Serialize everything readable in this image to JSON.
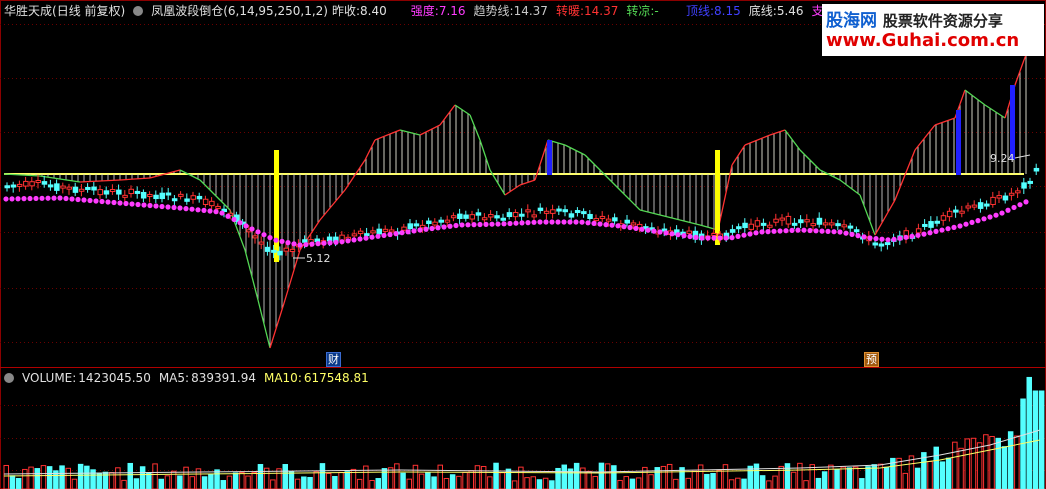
{
  "header": {
    "stock_name": "华胜天成",
    "period": "(日线 前复权)",
    "indicator": "凤凰波段倒仓(6,14,95,250,1,2)",
    "prev_close_label": "昨收:",
    "prev_close": "8.40",
    "strength_label": "强度:",
    "strength": "7.16",
    "trend_label": "趋势线:",
    "trend": "14.37",
    "turn_warm_label": "转暖:",
    "turn_warm": "14.37",
    "turn_cool_label": "转凉:",
    "turn_cool": "-",
    "top_line_label": "顶线:",
    "top_line": "8.15",
    "bottom_line_label": "底线:",
    "bottom_line": "5.46",
    "support_label": "支撑"
  },
  "watermark": {
    "brand": "股海网",
    "slogan": "股票软件资源分享",
    "url": "www.Guhai.com.cn"
  },
  "markers": {
    "low_price": "5.12",
    "high_price": "9.24",
    "tag_cai": "财",
    "tag_yu": "预"
  },
  "volume": {
    "label": "VOLUME:",
    "value": "1423045.50",
    "ma5_label": "MA5:",
    "ma5": "839391.94",
    "ma10_label": "MA10:",
    "ma10": "617548.81"
  },
  "colors": {
    "up": "#ff3232",
    "down": "#54ffff",
    "ma_dot": "#ff3cff",
    "zero_line": "#ffff66",
    "wave_up": "#ff3232",
    "wave_down": "#54d854",
    "signal_yellow": "#ffff00",
    "signal_blue": "#2020ff"
  }
}
